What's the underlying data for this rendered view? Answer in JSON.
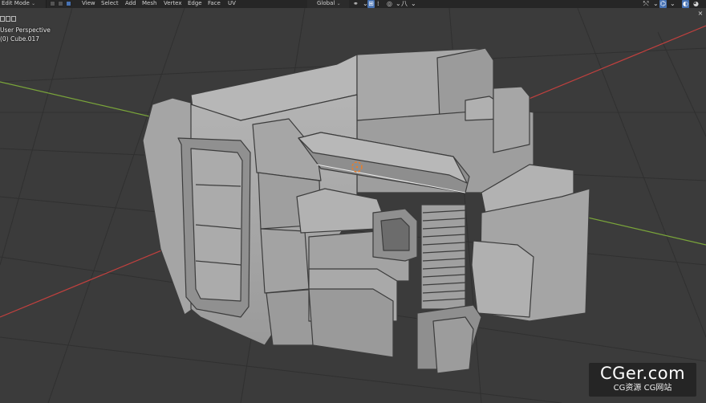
{
  "header": {
    "mode": "Edit Mode",
    "menus": [
      "View",
      "Select",
      "Add",
      "Mesh",
      "Vertex",
      "Edge",
      "Face",
      "UV"
    ],
    "transform_orientation": "Global"
  },
  "viewport": {
    "view_name": "User Perspective",
    "object_name": "(0) Cube.017"
  },
  "watermark": {
    "title": "CGer.com",
    "subtitle": "CG资源 CG网站"
  },
  "colors": {
    "grid_bg": "#3a3a3a",
    "x_axis": "#c2403e",
    "y_axis": "#7aa53a",
    "mesh_face": "#a3a3a3",
    "active_blue": "#4772b3",
    "cursor": "#e87d2a"
  },
  "icons": {
    "select_modes": [
      "vertex-select-icon",
      "edge-select-icon",
      "face-select-icon"
    ],
    "header_right": [
      "gizmo-icon",
      "overlay-icon",
      "xray-icon",
      "shading-icon"
    ]
  }
}
